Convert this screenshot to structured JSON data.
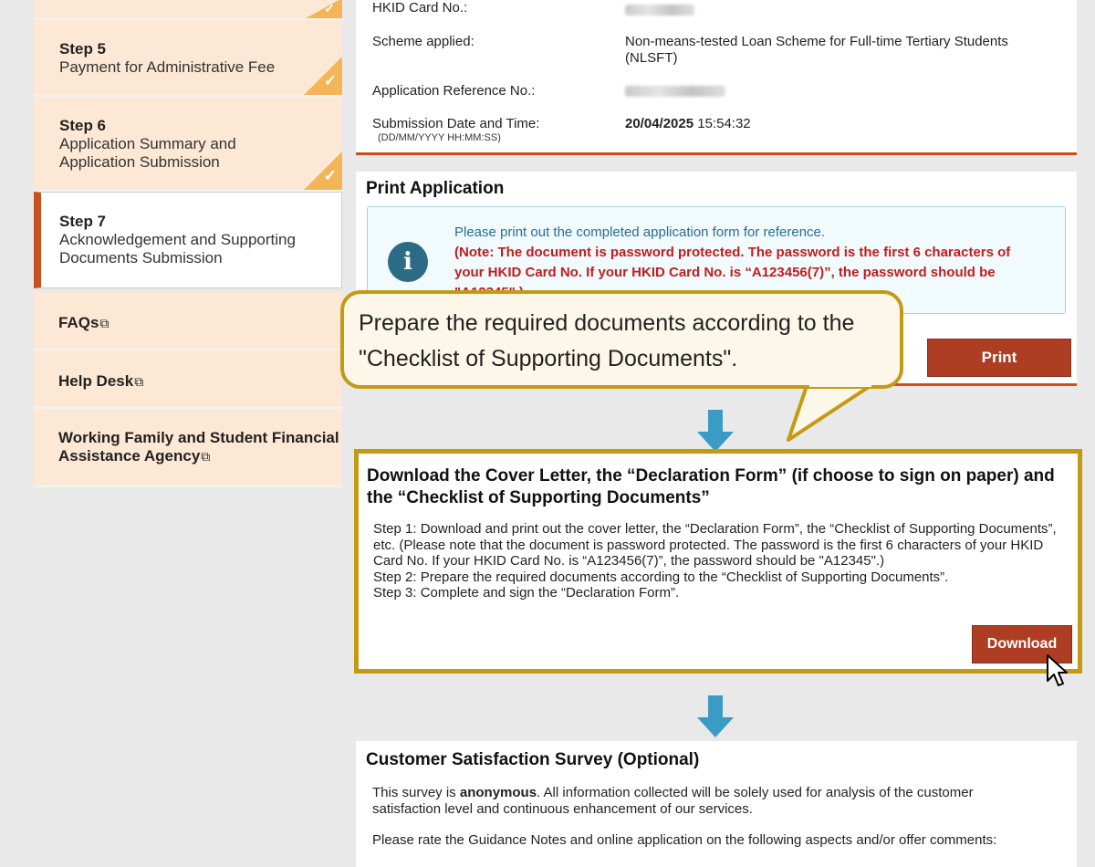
{
  "sidebar": {
    "step5": {
      "num": "Step 5",
      "desc": "Payment for Administrative Fee"
    },
    "step6": {
      "num": "Step 6",
      "desc": "Application Summary and Application Submission"
    },
    "step7": {
      "num": "Step 7",
      "desc": "Acknowledgement and Supporting Documents Submission"
    },
    "check_glyph": "✓",
    "ext_glyph": "⧉",
    "links": {
      "faqs": "FAQs",
      "help_desk": "Help Desk",
      "wfsfaa": "Working Family and Student Financial Assistance Agency"
    }
  },
  "summary": {
    "hkid_label": "HKID Card No.:",
    "scheme_label": "Scheme applied:",
    "scheme_value": "Non-means-tested Loan Scheme for Full-time Tertiary Students (NLSFT)",
    "ref_label": "Application Reference No.:",
    "submission_label": "Submission Date and Time:",
    "submission_hint": "(DD/MM/YYYY HH:MM:SS)",
    "submission_date": "20/04/2025",
    "submission_time": "15:54:32"
  },
  "print_section": {
    "title": "Print Application",
    "notice_line": "Please print out the completed application form for reference.",
    "notice_note": "(Note: The document is password protected. The password is the first 6 characters of your HKID Card No. If your HKID Card No. is “A123456(7)”, the password should be \"A12345\".)",
    "button": "Print"
  },
  "callout": {
    "text": "Prepare the required documents according to the \"Checklist of Supporting Documents\"."
  },
  "download_section": {
    "title": "Download the Cover Letter, the “Declaration Form” (if choose to sign on paper) and the “Checklist of Supporting Documents”",
    "step1": "Step 1: Download and print out the cover letter, the “Declaration Form”, the “Checklist of Supporting Documents”, etc. (Please note that the document is password protected. The password is the first 6 characters of your HKID Card No. If your HKID Card No. is “A123456(7)”, the password should be \"A12345\".)",
    "step2": "Step 2: Prepare the required documents according to the “Checklist of Supporting Documents”.",
    "step3": "Step 3: Complete and sign the “Declaration Form”.",
    "button": "Download"
  },
  "survey_section": {
    "title": "Customer Satisfaction Survey (Optional)",
    "intro_before": "This survey is ",
    "intro_bold": "anonymous",
    "intro_after": ". All information collected will be solely used for analysis of the customer satisfaction level and continuous enhancement of our services.",
    "rate_text": "Please rate the Guidance Notes and online application on the following aspects and/or offer comments:"
  },
  "colors": {
    "accent": "#c8501f",
    "button": "#ad3e24",
    "highlight_border": "#c49a14",
    "sidebar_bg": "#fde8d5",
    "check_corner": "#f4b558",
    "arrow": "#3a9cc4"
  }
}
